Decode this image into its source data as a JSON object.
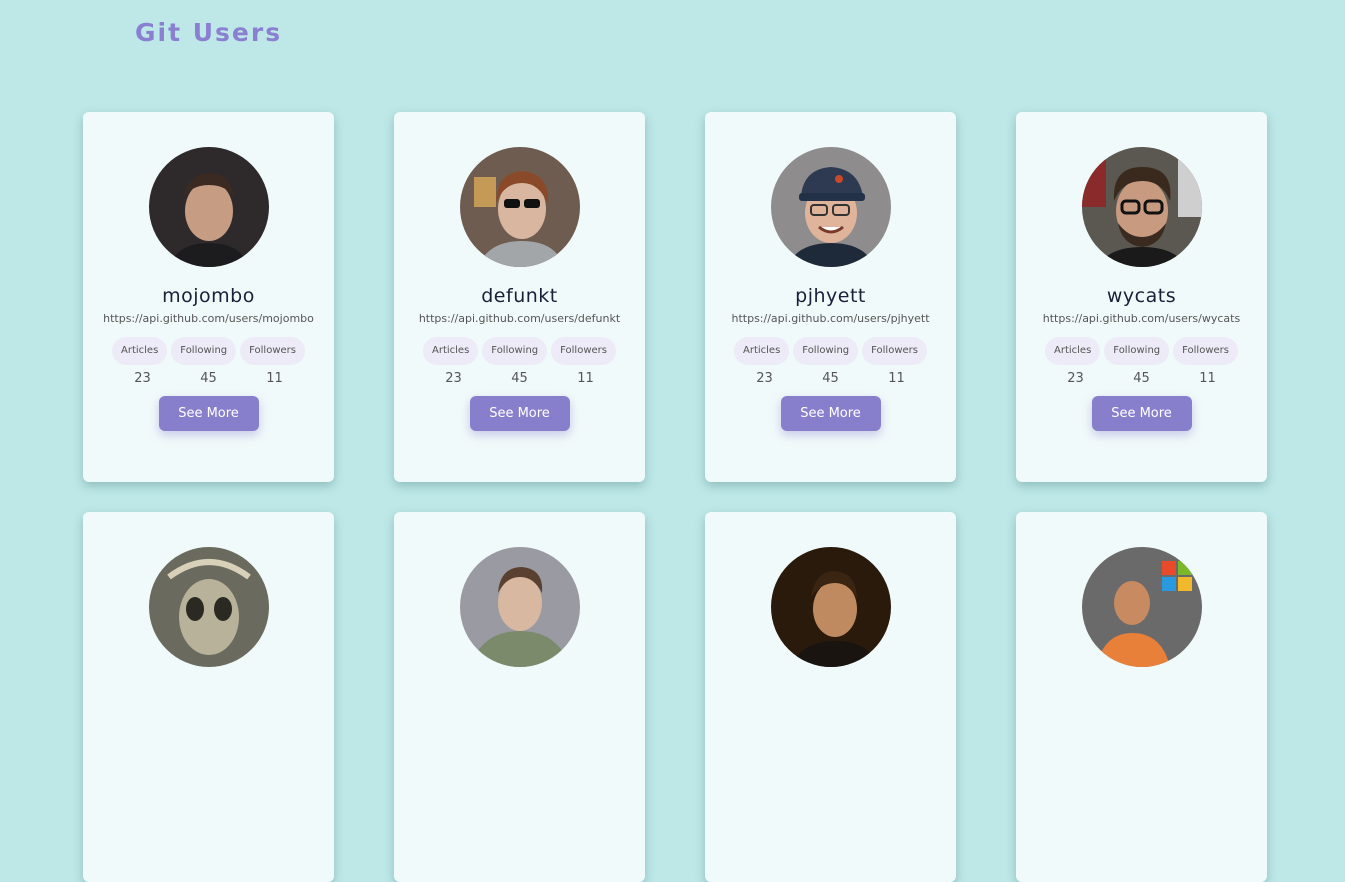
{
  "header": {
    "title": "Git Users"
  },
  "stat_labels": {
    "articles": "Articles",
    "following": "Following",
    "followers": "Followers"
  },
  "button_label": "See More",
  "users": [
    {
      "login": "mojombo",
      "url": "https://api.github.com/users/mojombo",
      "articles": "23",
      "following": "45",
      "followers": "11"
    },
    {
      "login": "defunkt",
      "url": "https://api.github.com/users/defunkt",
      "articles": "23",
      "following": "45",
      "followers": "11"
    },
    {
      "login": "pjhyett",
      "url": "https://api.github.com/users/pjhyett",
      "articles": "23",
      "following": "45",
      "followers": "11"
    },
    {
      "login": "wycats",
      "url": "https://api.github.com/users/wycats",
      "articles": "23",
      "following": "45",
      "followers": "11"
    }
  ],
  "avatar_colors": [
    "#3a3030",
    "#6e5a4a",
    "#8a8a8a",
    "#3b342c",
    "#8d8a7a",
    "#8f8e85",
    "#3a2a18",
    "#8a6a4a"
  ]
}
